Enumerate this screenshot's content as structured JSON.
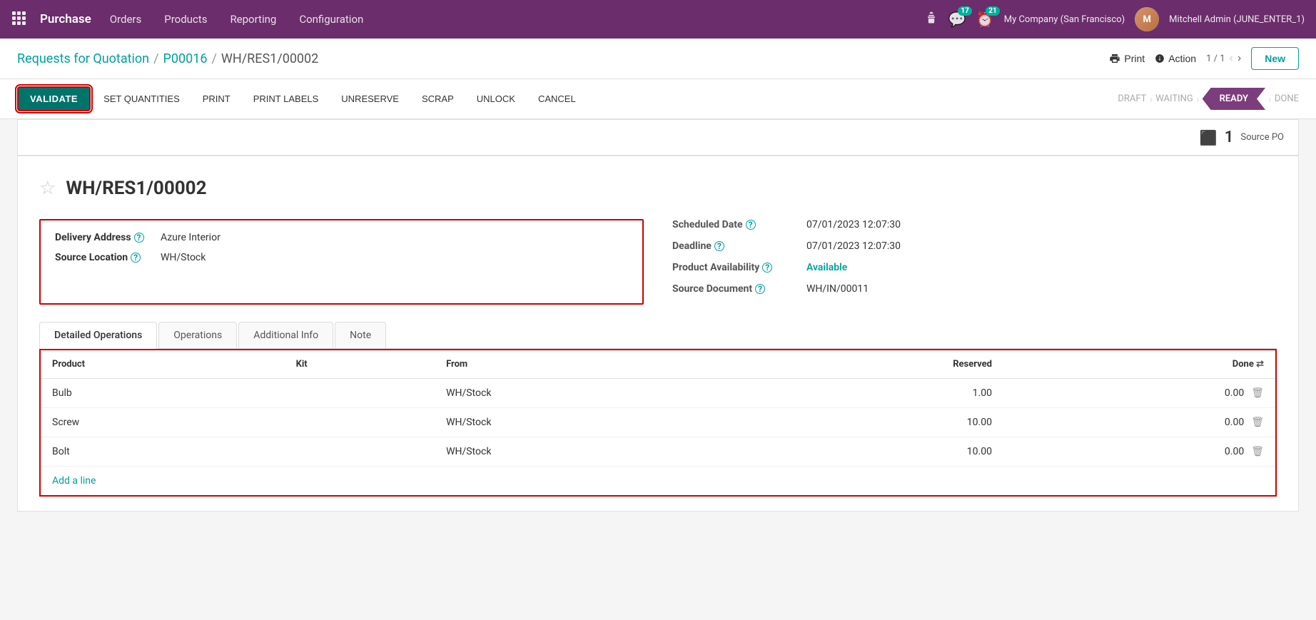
{
  "topnav": {
    "brand": "Purchase",
    "nav_items": [
      "Orders",
      "Products",
      "Reporting",
      "Configuration"
    ],
    "notifications_count": "17",
    "activity_count": "21",
    "company": "My Company (San Francisco)",
    "user": "Mitchell Admin (JUNE_ENTER_1)"
  },
  "breadcrumb": {
    "parts": [
      "Requests for Quotation",
      "P00016",
      "WH/RES1/00002"
    ],
    "separators": [
      "/",
      "/"
    ]
  },
  "header_actions": {
    "print_label": "Print",
    "action_label": "Action",
    "pagination": "1 / 1",
    "new_label": "New"
  },
  "action_bar": {
    "validate": "VALIDATE",
    "set_quantities": "SET QUANTITIES",
    "print": "PRINT",
    "print_labels": "PRINT LABELS",
    "unreserve": "UNRESERVE",
    "scrap": "SCRAP",
    "unlock": "UNLOCK",
    "cancel": "CANCEL"
  },
  "status_steps": [
    "DRAFT",
    "WAITING",
    "READY",
    "DONE"
  ],
  "active_step": "READY",
  "source_po": {
    "count": "1",
    "label": "Source PO"
  },
  "document": {
    "title": "WH/RES1/00002",
    "delivery_address_label": "Delivery Address",
    "delivery_address_value": "Azure Interior",
    "source_location_label": "Source Location",
    "source_location_value": "WH/Stock",
    "scheduled_date_label": "Scheduled Date",
    "scheduled_date_value": "07/01/2023 12:07:30",
    "deadline_label": "Deadline",
    "deadline_value": "07/01/2023 12:07:30",
    "product_availability_label": "Product Availability",
    "product_availability_value": "Available",
    "source_document_label": "Source Document",
    "source_document_value": "WH/IN/00011"
  },
  "tabs": [
    "Detailed Operations",
    "Operations",
    "Additional Info",
    "Note"
  ],
  "active_tab": "Detailed Operations",
  "table": {
    "headers": [
      "Product",
      "Kit",
      "From",
      "Reserved",
      "Done"
    ],
    "rows": [
      {
        "product": "Bulb",
        "kit": "",
        "from": "WH/Stock",
        "reserved": "1.00",
        "done": "0.00"
      },
      {
        "product": "Screw",
        "kit": "",
        "from": "WH/Stock",
        "reserved": "10.00",
        "done": "0.00"
      },
      {
        "product": "Bolt",
        "kit": "",
        "from": "WH/Stock",
        "reserved": "10.00",
        "done": "0.00"
      }
    ],
    "add_line": "Add a line"
  },
  "colors": {
    "primary": "#6b2d6b",
    "teal": "#00a09d",
    "active_step_bg": "#7c3d7c",
    "red_border": "#cc0000",
    "validate_bg": "#00736b"
  }
}
